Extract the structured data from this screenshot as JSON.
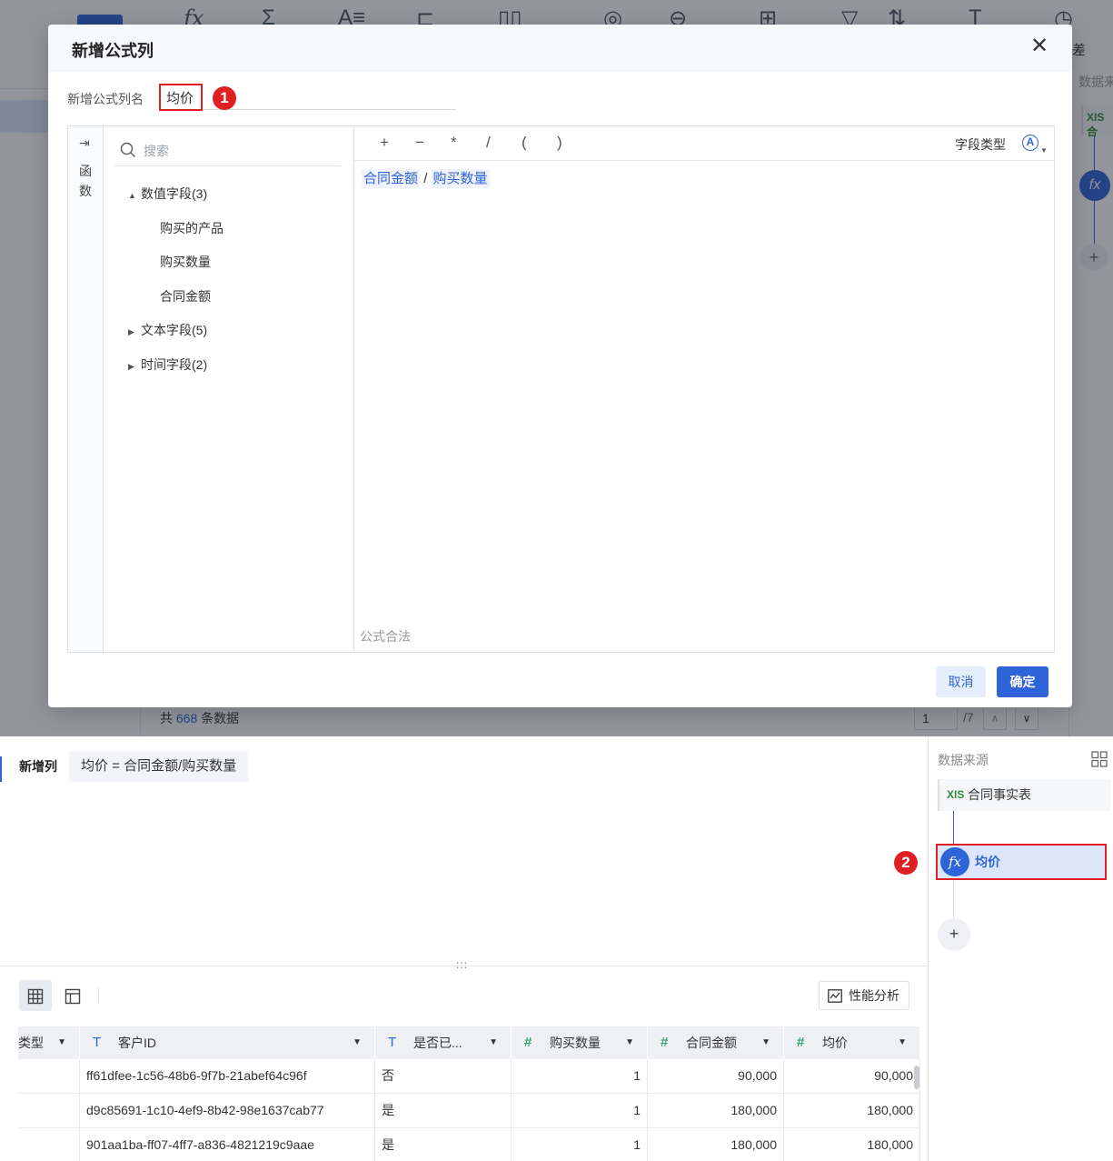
{
  "background": {
    "toolbar_icons": [
      "fx-icon",
      "sigma-icon",
      "text-format-icon",
      "group-icon",
      "column-icon",
      "merge-icon",
      "join-icon",
      "hierarchy-icon",
      "filter-icon",
      "sort-icon",
      "text-icon",
      "history-icon"
    ],
    "right_panel_label": "数据来",
    "right_panel_cut": "差",
    "right_panel_src": "合",
    "footer_prefix": "共",
    "footer_count": "668",
    "footer_suffix": "条数据",
    "page_current": "1",
    "page_total": "/7"
  },
  "dialog": {
    "title": "新增公式列",
    "close_label": "✕",
    "name_label": "新增公式列名",
    "name_value": "均价",
    "badge_1": "1",
    "function_toggle": "⇥",
    "function_label": "函数",
    "search_placeholder": "搜索",
    "tree": [
      {
        "label": "数值字段(3)",
        "caret": "▲",
        "expanded": true
      },
      {
        "label": "购买的产品"
      },
      {
        "label": "购买数量"
      },
      {
        "label": "合同金额"
      },
      {
        "label": "文本字段(5)",
        "caret": "▶",
        "expanded": false
      },
      {
        "label": "时间字段(2)",
        "caret": "▶",
        "expanded": false
      }
    ],
    "operators": [
      "+",
      "−",
      "*",
      "/",
      "(",
      ")"
    ],
    "field_type_label": "字段类型",
    "field_type_icon": "A",
    "formula": {
      "field1": "合同金额",
      "op": "/",
      "field2": "购买数量"
    },
    "status": "公式合法",
    "cancel_label": "取消",
    "confirm_label": "确定"
  },
  "step": {
    "label": "新增列",
    "formula_text": "均价 = 合同金额/购买数量"
  },
  "divider": ":::",
  "performance_label": "性能分析",
  "table": {
    "columns": [
      {
        "label": "类型",
        "type": "text"
      },
      {
        "label": "客户ID",
        "type": "text"
      },
      {
        "label": "是否已...",
        "type": "text"
      },
      {
        "label": "购买数量",
        "type": "number"
      },
      {
        "label": "合同金额",
        "type": "number"
      },
      {
        "label": "均价",
        "type": "number"
      }
    ],
    "rows": [
      [
        "",
        "ff61dfee-1c56-48b6-9f7b-21abef64c96f",
        "否",
        "1",
        "90,000",
        "90,000"
      ],
      [
        "",
        "d9c85691-1c10-4ef9-8b42-98e1637cab77",
        "是",
        "1",
        "180,000",
        "180,000"
      ],
      [
        "",
        "901aa1ba-ff07-4ff7-a836-4821219c9aae",
        "是",
        "1",
        "180,000",
        "180,000"
      ]
    ]
  },
  "side": {
    "title": "数据来源",
    "source_icon": "XIS",
    "source_label": "合同事实表",
    "step_icon": "fx",
    "step_label": "均价",
    "badge_2": "2",
    "add_label": "+"
  }
}
